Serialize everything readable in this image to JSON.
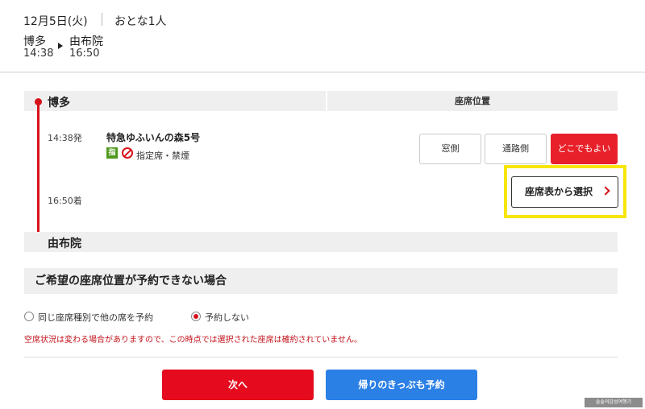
{
  "header": {
    "date": "12月5日(火)",
    "passengers": "おとな1人",
    "from_station": "博多",
    "from_time": "14:38",
    "to_station": "由布院",
    "to_time": "16:50"
  },
  "route": {
    "origin": "博多",
    "destination": "由布院",
    "seat_position_header": "座席位置",
    "depart_time": "14:38発",
    "arrive_time": "16:50着",
    "train_name": "特急ゆふいんの森5号",
    "reserved_icon_text": "指",
    "seat_type": "指定席・禁煙"
  },
  "seat_options": [
    {
      "label": "窓側",
      "selected": false
    },
    {
      "label": "通路側",
      "selected": false
    },
    {
      "label": "どこでもよい",
      "selected": true
    }
  ],
  "seat_chart_button": "座席表から選択",
  "fallback": {
    "title": "ご希望の座席位置が予約できない場合",
    "options": [
      {
        "label": "同じ座席種別で他の席を予約",
        "selected": false
      },
      {
        "label": "予約しない",
        "selected": true
      }
    ],
    "notice": "空席状況は変わる場合がありますので、この時点では選択された座席は確約されていません。"
  },
  "actions": {
    "next": "次へ",
    "return_trip": "帰りのきっぷも予約"
  },
  "watermark": "솔솔의감성여행기",
  "colors": {
    "accent_red": "#e50a1e",
    "blue": "#2b80e6",
    "highlight_yellow": "#f7e60b"
  }
}
